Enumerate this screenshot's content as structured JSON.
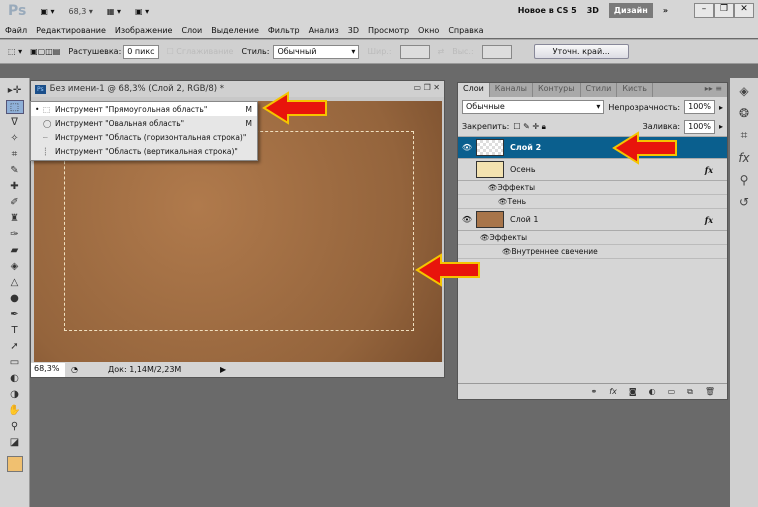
{
  "appbar": {
    "logo": "Ps",
    "zoom": "68,3",
    "workspaces": [
      "Новое в CS 5",
      "3D",
      "Дизайн"
    ],
    "active_workspace": "Дизайн",
    "more": "»"
  },
  "menu": [
    "Файл",
    "Редактирование",
    "Изображение",
    "Слои",
    "Выделение",
    "Фильтр",
    "Анализ",
    "3D",
    "Просмотр",
    "Окно",
    "Справка"
  ],
  "options": {
    "feather_label": "Растушевка:",
    "feather_value": "0 пикс",
    "antialias_label": "Сглаживание",
    "style_label": "Стиль:",
    "style_value": "Обычный",
    "width_label": "Шир.:",
    "height_label": "Выс.:",
    "refine_label": "Уточн. край..."
  },
  "document": {
    "title": "Без имени-1 @ 68,3% (Слой 2, RGB/8) *",
    "zoom": "68,3%",
    "doc_info": "Док: 1,14M/2,23M"
  },
  "flyout": [
    {
      "label": "Инструмент \"Прямоугольная область\"",
      "key": "M",
      "selected": true,
      "icon": "rect-marquee-icon"
    },
    {
      "label": "Инструмент \"Овальная область\"",
      "key": "M",
      "selected": false,
      "icon": "ellipse-marquee-icon"
    },
    {
      "label": "Инструмент \"Область (горизонтальная строка)\"",
      "key": "",
      "selected": false,
      "icon": "row-marquee-icon"
    },
    {
      "label": "Инструмент \"Область (вертикальная строка)\"",
      "key": "",
      "selected": false,
      "icon": "column-marquee-icon"
    }
  ],
  "layers_panel": {
    "tabs": [
      "Слои",
      "Каналы",
      "Контуры",
      "Стили",
      "Кисть"
    ],
    "active_tab": "Слои",
    "blend_mode": "Обычные",
    "opacity_label": "Непрозрачность:",
    "opacity": "100%",
    "lock_label": "Закрепить:",
    "fill_label": "Заливка:",
    "fill": "100%",
    "layers": [
      {
        "name": "Слой 2",
        "selected": true,
        "visible": true
      },
      {
        "name": "Осень",
        "selected": false,
        "visible": false,
        "fx": "fx",
        "effects_label": "Эффекты",
        "effects": [
          "Тень"
        ]
      },
      {
        "name": "Слой 1",
        "selected": false,
        "visible": true,
        "fx": "fx",
        "effects_label": "Эффекты",
        "effects": [
          "Внутреннее свечение"
        ]
      }
    ]
  },
  "colors": {
    "selection": "#0a5f8e",
    "arrow": "#e8140c",
    "arrow_outline": "#f5c400",
    "foreground": "#f0c070"
  }
}
